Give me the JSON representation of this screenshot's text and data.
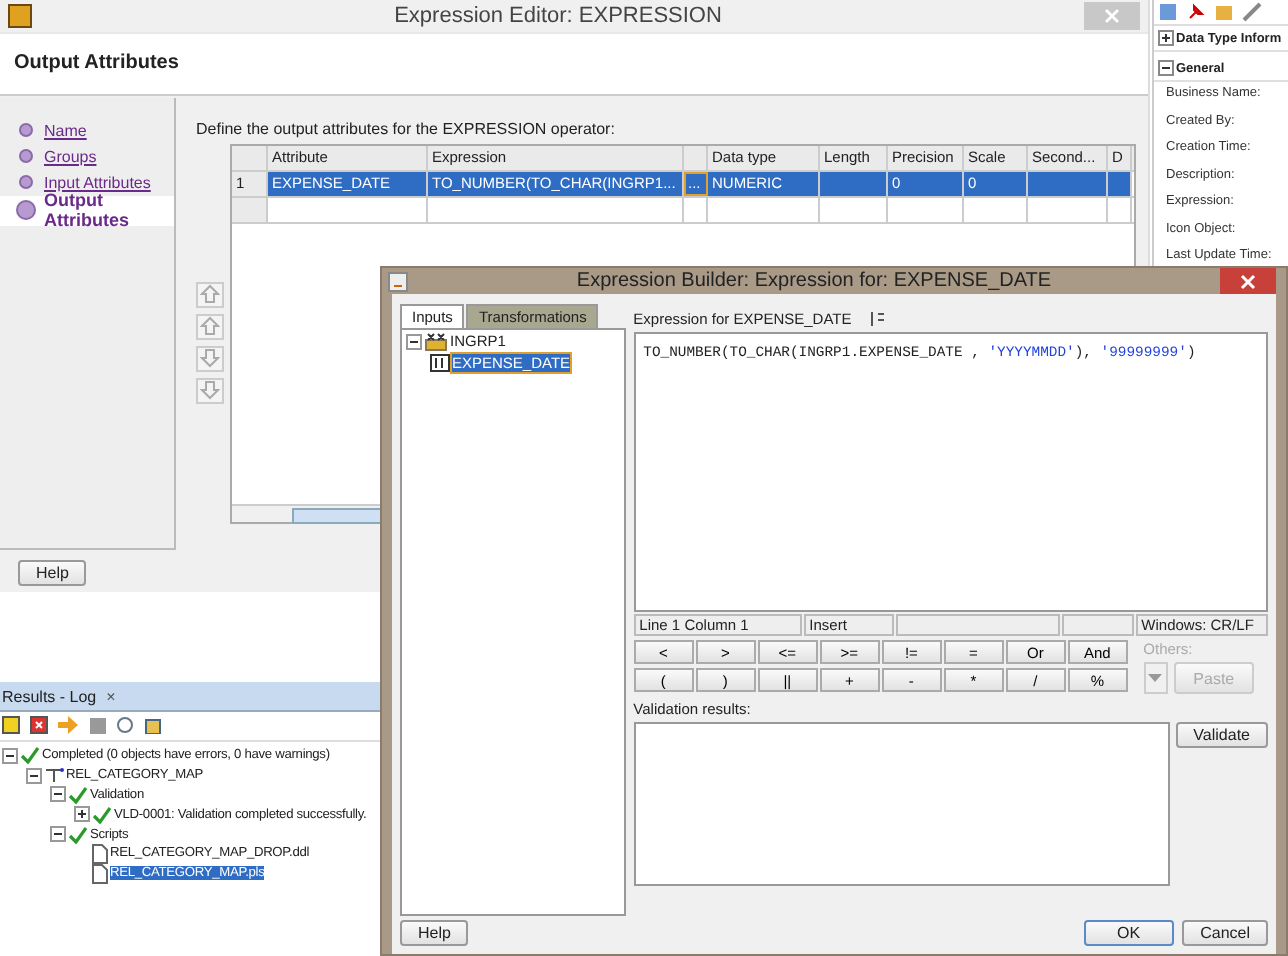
{
  "editor": {
    "title": "Expression Editor: EXPRESSION",
    "heading": "Output Attributes",
    "steps": [
      {
        "label": "Name",
        "selected": false
      },
      {
        "label": "Groups",
        "selected": false
      },
      {
        "label": "Input Attributes",
        "selected": false
      },
      {
        "label": "Output Attributes",
        "selected": true
      }
    ],
    "instruction": "Define the output attributes for the EXPRESSION operator:",
    "columns": [
      {
        "label": "Attribute"
      },
      {
        "label": "Expression"
      },
      {
        "kind": "ellipsis"
      },
      {
        "label": "Data type"
      },
      {
        "label": "Length"
      },
      {
        "label": "Precision"
      },
      {
        "label": "Scale"
      },
      {
        "label": "Second..."
      },
      {
        "label": "D"
      }
    ],
    "rows": [
      {
        "number": "1",
        "selected": true,
        "cells": [
          "EXPENSE_DATE",
          "TO_NUMBER(TO_CHAR(INGRP1...",
          "...",
          "NUMERIC",
          null,
          "0",
          "0",
          null,
          null
        ]
      }
    ],
    "help": "Help"
  },
  "properties": {
    "sections": [
      {
        "label": "Data Type Inform",
        "expanded": false
      },
      {
        "label": "General",
        "expanded": true
      }
    ],
    "fields": [
      "Business Name:",
      "Created By:",
      "Creation Time:",
      "Description:",
      "Expression:",
      "Icon Object:",
      "Last Update Time:"
    ]
  },
  "log": {
    "tab": "Results - Log",
    "close": "×",
    "tree": [
      {
        "label": "Completed (0 objects have errors, 0 have warnings)",
        "kind": "ok",
        "expanded": true,
        "selected": false,
        "children": [
          {
            "label": "REL_CATEGORY_MAP",
            "kind": "map",
            "expanded": true,
            "selected": false,
            "children": [
              {
                "label": "Validation",
                "kind": "ok",
                "expanded": true,
                "selected": false,
                "children": [
                  {
                    "label": "VLD-0001: Validation completed successfully.",
                    "kind": "ok",
                    "expanded": false,
                    "selected": false
                  }
                ]
              },
              {
                "label": "Scripts",
                "kind": "ok",
                "expanded": true,
                "selected": false,
                "children": [
                  {
                    "label": "REL_CATEGORY_MAP_DROP.ddl",
                    "kind": "file",
                    "selected": false
                  },
                  {
                    "label": "REL_CATEGORY_MAP.pls",
                    "kind": "file",
                    "selected": true
                  }
                ]
              }
            ]
          }
        ]
      }
    ]
  },
  "builder": {
    "title": "Expression Builder: Expression for: EXPENSE_DATE",
    "tabs": [
      {
        "label": "Inputs",
        "selected": true
      },
      {
        "label": "Transformations",
        "selected": false
      }
    ],
    "tree": [
      {
        "label": "INGRP1",
        "kind": "group",
        "expanded": true,
        "selected": false,
        "children": [
          {
            "label": "EXPENSE_DATE",
            "kind": "attribute",
            "selected": true
          }
        ]
      }
    ],
    "expression_label": "Expression for EXPENSE_DATE",
    "expression": [
      {
        "kind": "code",
        "text": "TO_NUMBER(TO_CHAR(INGRP1.EXPENSE_DATE , "
      },
      {
        "kind": "string",
        "text": "'YYYYMMDD'"
      },
      {
        "kind": "code",
        "text": "), "
      },
      {
        "kind": "string",
        "text": "'99999999'"
      },
      {
        "kind": "code",
        "text": ")"
      }
    ],
    "status": [
      "Line 1 Column 1",
      "Insert",
      "Windows: CR/LF"
    ],
    "operators": [
      "<",
      ">",
      "<=",
      ">=",
      "!=",
      "=",
      "Or",
      "And",
      "(",
      ")",
      "||",
      "+",
      "-",
      "*",
      "/",
      "%"
    ],
    "others": {
      "label": "Others:",
      "disabled": true
    },
    "paste": {
      "label": "Paste",
      "disabled": true
    },
    "validation_label": "Validation results:",
    "validate": "Validate",
    "help": "Help",
    "ok": "OK",
    "cancel": "Cancel"
  }
}
